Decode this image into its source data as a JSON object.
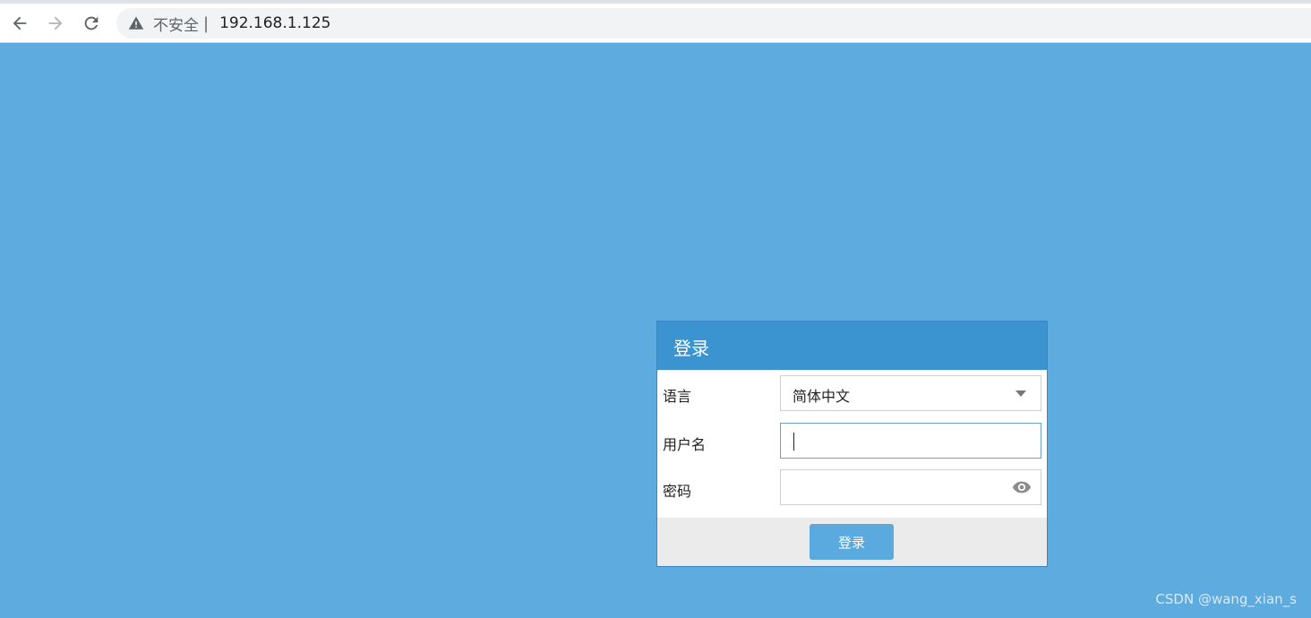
{
  "browser": {
    "security_label": "不安全",
    "separator": "|",
    "url": "192.168.1.125"
  },
  "login": {
    "title": "登录",
    "language_label": "语言",
    "language_value": "简体中文",
    "username_label": "用户名",
    "username_value": "",
    "password_label": "密码",
    "password_value": "",
    "submit_label": "登录"
  },
  "watermark": "CSDN @wang_xian_s",
  "colors": {
    "page_background": "#5dabdf",
    "dialog_header": "#3b94d0",
    "login_button": "#5aa9df",
    "footer": "#ebebeb"
  },
  "icons": [
    "back-arrow-icon",
    "forward-arrow-icon",
    "reload-icon",
    "warning-icon",
    "dropdown-caret-icon",
    "eye-icon"
  ]
}
